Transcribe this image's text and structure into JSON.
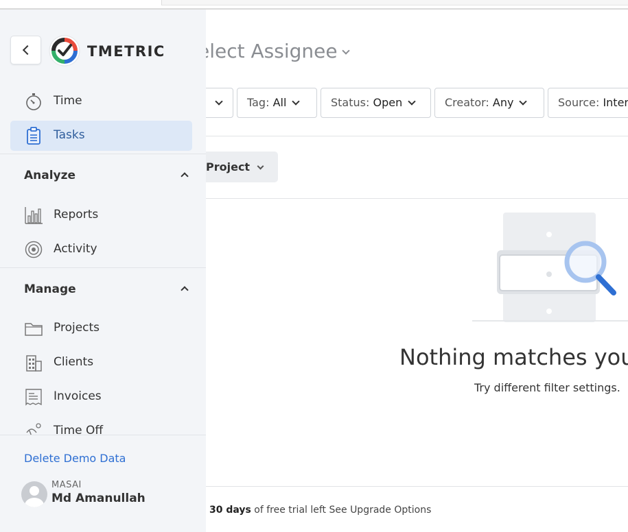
{
  "app": {
    "brand": "TMETRIC"
  },
  "header": {
    "title": "elect Assignee"
  },
  "filters": [
    {
      "key": "",
      "value": ""
    },
    {
      "key": "Tag: ",
      "value": "All"
    },
    {
      "key": "Status: ",
      "value": "Open"
    },
    {
      "key": "Creator: ",
      "value": "Any"
    },
    {
      "key": "Source: ",
      "value": "Inter"
    }
  ],
  "group_by": {
    "label": "Project"
  },
  "empty_state": {
    "title": "Nothing matches you",
    "subtitle": "Try different filter settings."
  },
  "trial": {
    "days": "30 days",
    "text": " of free trial left ",
    "link": "See Upgrade Options"
  },
  "sidebar": {
    "top_items": [
      {
        "label": "Time",
        "icon": "stopwatch-icon"
      },
      {
        "label": "Tasks",
        "icon": "clipboard-icon",
        "active": true
      }
    ],
    "analyze": {
      "label": "Analyze",
      "items": [
        {
          "label": "Reports",
          "icon": "bar-chart-icon"
        },
        {
          "label": "Activity",
          "icon": "activity-icon"
        }
      ]
    },
    "manage": {
      "label": "Manage",
      "items": [
        {
          "label": "Projects",
          "icon": "folder-icon"
        },
        {
          "label": "Clients",
          "icon": "building-icon"
        },
        {
          "label": "Invoices",
          "icon": "invoice-icon"
        },
        {
          "label": "Time Off",
          "icon": "palm-tree-icon"
        }
      ]
    },
    "demo_link": "Delete Demo Data",
    "user": {
      "org": "MASAI",
      "name": "Md Amanullah"
    }
  },
  "colors": {
    "accent": "#2e6fd3",
    "active_bg": "#dde8f7",
    "sidebar_bg": "#f3f5f8"
  }
}
